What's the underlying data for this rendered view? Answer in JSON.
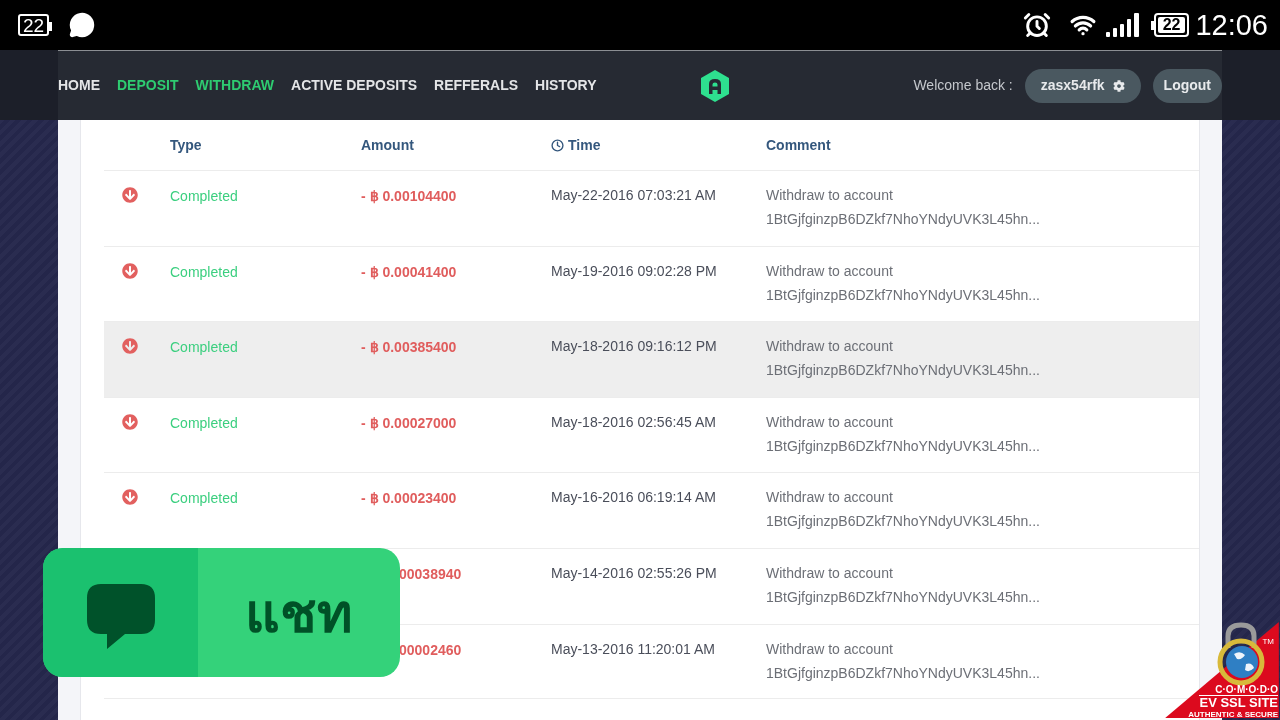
{
  "status_bar": {
    "notification_badge": "22",
    "battery": "22",
    "time": "12:06"
  },
  "nav": {
    "items": [
      {
        "label": "HOME",
        "selected": false
      },
      {
        "label": "DEPOSIT",
        "selected": true
      },
      {
        "label": "WITHDRAW",
        "selected": true
      },
      {
        "label": "ACTIVE DEPOSITS",
        "selected": false
      },
      {
        "label": "REFFERALS",
        "selected": false
      },
      {
        "label": "HISTORY",
        "selected": false
      }
    ],
    "welcome": "Welcome back :",
    "username": "zasx54rfk",
    "logout": "Logout"
  },
  "table": {
    "columns": [
      {
        "label": "Type",
        "kind": "text"
      },
      {
        "label": "Amount",
        "kind": "text"
      },
      {
        "label": "Time",
        "kind": "time"
      },
      {
        "label": "Comment",
        "kind": "text"
      }
    ],
    "rows": [
      {
        "status": "Completed",
        "amount": "- ฿ 0.00104400",
        "time": "May-22-2016 07:03:21 AM",
        "comment": "Withdraw to account 1BtGjfginzpB6DZkf7NhoYNdyUVK3L45hn...",
        "selected": false
      },
      {
        "status": "Completed",
        "amount": "- ฿ 0.00041400",
        "time": "May-19-2016 09:02:28 PM",
        "comment": "Withdraw to account 1BtGjfginzpB6DZkf7NhoYNdyUVK3L45hn...",
        "selected": false
      },
      {
        "status": "Completed",
        "amount": "- ฿ 0.00385400",
        "time": "May-18-2016 09:16:12 PM",
        "comment": "Withdraw to account 1BtGjfginzpB6DZkf7NhoYNdyUVK3L45hn...",
        "selected": true
      },
      {
        "status": "Completed",
        "amount": "- ฿ 0.00027000",
        "time": "May-18-2016 02:56:45 AM",
        "comment": "Withdraw to account 1BtGjfginzpB6DZkf7NhoYNdyUVK3L45hn...",
        "selected": false
      },
      {
        "status": "Completed",
        "amount": "- ฿ 0.00023400",
        "time": "May-16-2016 06:19:14 AM",
        "comment": "Withdraw to account 1BtGjfginzpB6DZkf7NhoYNdyUVK3L45hn...",
        "selected": false
      },
      {
        "amount": "00038940",
        "time": "May-14-2016 02:55:26 PM",
        "comment": "Withdraw to account 1BtGjfginzpB6DZkf7NhoYNdyUVK3L45hn...",
        "selected": false
      },
      {
        "amount": "00002460",
        "time": "May-13-2016 11:20:01 AM",
        "comment": "Withdraw to account 1BtGjfginzpB6DZkf7NhoYNdyUVK3L45hn...",
        "selected": false
      }
    ]
  },
  "chat_widget": {
    "label": "แชท"
  },
  "ssl_seal": {
    "trademark": "TM",
    "brand": "C·O·M·O·D·O",
    "title": "EV SSL SITE",
    "subtitle": "AUTHENTIC & SECURE"
  }
}
